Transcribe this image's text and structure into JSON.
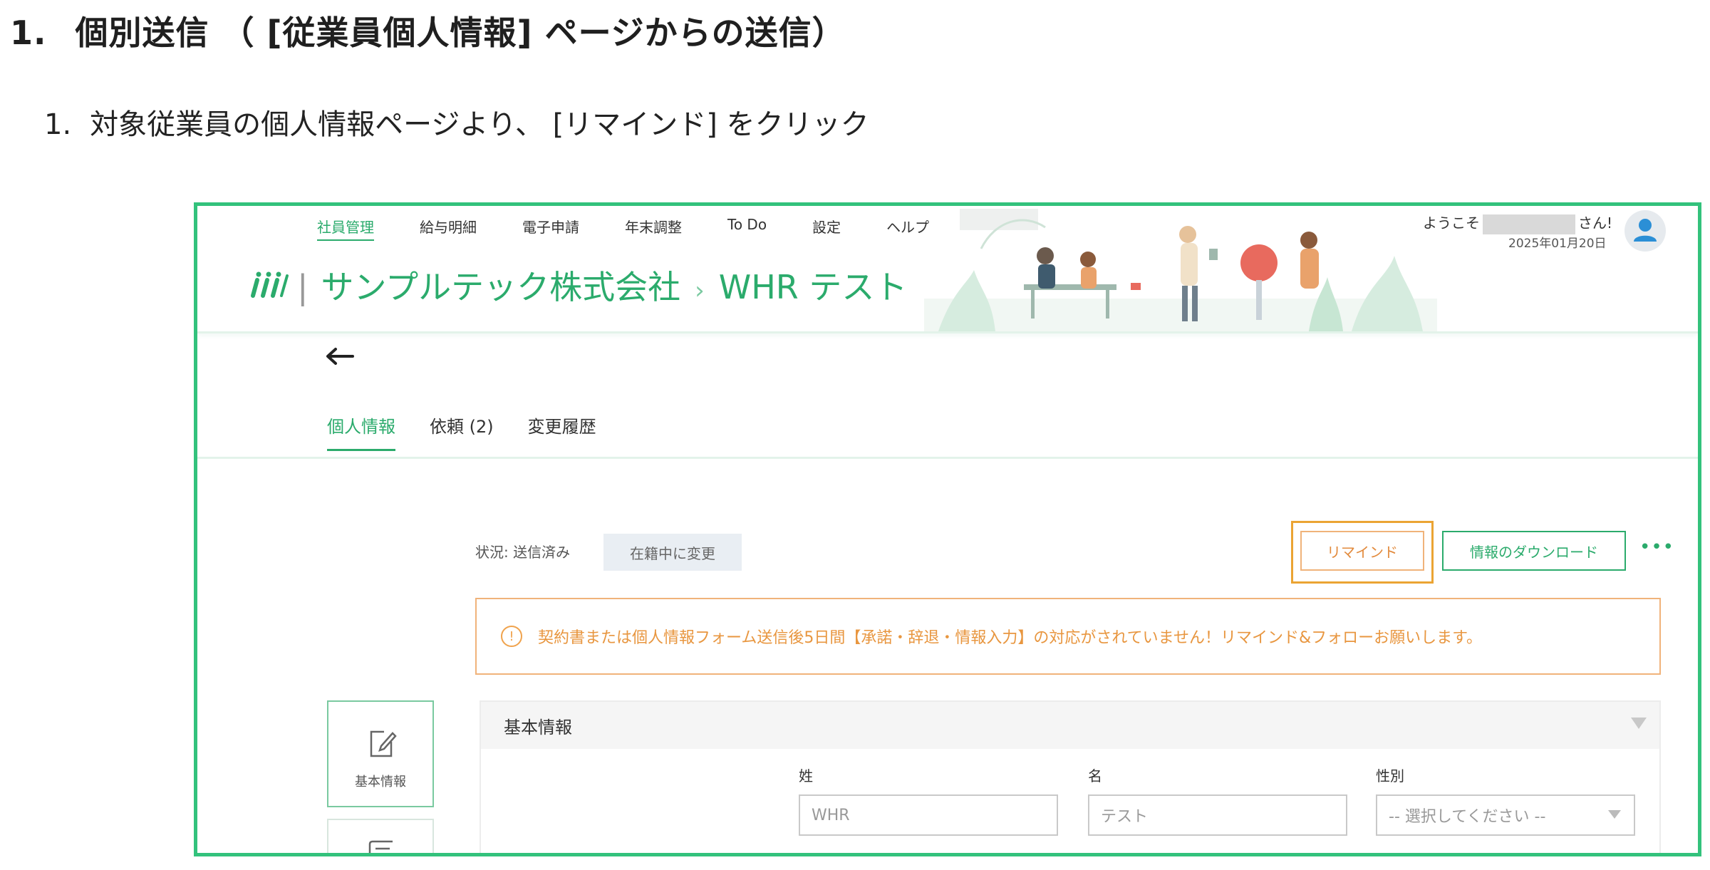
{
  "doc": {
    "heading_number": "1.",
    "heading_text": "個別送信 （ [従業員個人情報] ページからの送信）",
    "step_number": "1.",
    "step_text": "対象従業員の個人情報ページより、 [リマインド] をクリック"
  },
  "app": {
    "nav": [
      "社員管理",
      "給与明細",
      "電子申請",
      "年末調整",
      "To Do",
      "設定",
      "ヘルプ"
    ],
    "welcome_prefix": "ようこそ",
    "welcome_suffix": "さん!",
    "date": "2025年01月20日",
    "company": "サンプルテック株式会社",
    "employee": "WHR テスト",
    "tabs": [
      "個人情報",
      "依頼 (2)",
      "変更履歴"
    ],
    "status": "状況: 送信済み",
    "change_button": "在籍中に変更",
    "remind_button": "リマインド",
    "download_button": "情報のダウンロード",
    "more": "•••",
    "alert_icon": "!",
    "alert_text": "契約書または個人情報フォーム送信後5日間【承諾・辞退・情報入力】の対応がされていません！リマインド&フォローお願いします。",
    "side_card_label": "基本情報",
    "section_title": "基本情報",
    "fields": {
      "last_name_label": "姓",
      "last_name_value": "WHR",
      "first_name_label": "名",
      "first_name_value": "テスト",
      "gender_label": "性別",
      "gender_placeholder": "-- 選択してください --"
    }
  },
  "colors": {
    "frame": "#33c27c",
    "brand": "#2bab6c",
    "highlight": "#eba433",
    "alert": "#e8963f"
  }
}
